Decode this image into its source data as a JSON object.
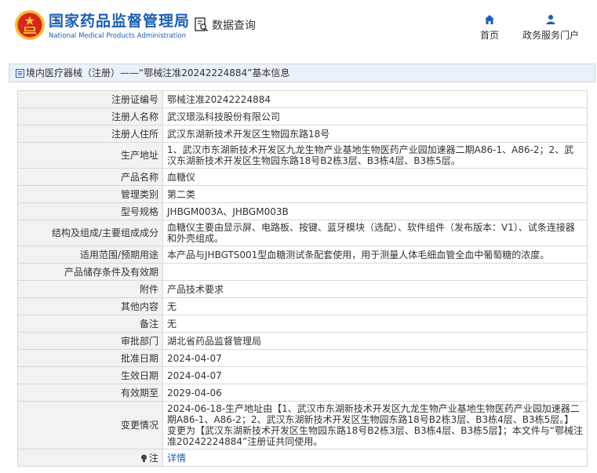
{
  "header": {
    "brand_cn": "国家药品监督管理局",
    "brand_en": "National Medical Products Administration",
    "query_label": "数据查询",
    "nav": {
      "home_label": "首页",
      "portal_label": "政务服务门户"
    }
  },
  "colors": {
    "brand_blue": "#1e5eb0",
    "emblem_red": "#d7261c",
    "emblem_gold": "#f0c030"
  },
  "breadcrumb": {
    "text": "境内医疗器械（注册）——“鄂械注准20242224884”基本信息"
  },
  "rows": [
    {
      "label": "注册证编号",
      "value": "鄂械注准20242224884"
    },
    {
      "label": "注册人名称",
      "value": "武汉璟泓科技股份有限公司"
    },
    {
      "label": "注册人住所",
      "value": "武汉东湖新技术开发区生物园东路18号"
    },
    {
      "label": "生产地址",
      "value": "1、武汉市东湖新技术开发区九龙生物产业基地生物医药产业园加速器二期A86-1、A86-2；2、武汉东湖新技术开发区生物园东路18号B2栋3层、B3栋4层、B3栋5层。"
    },
    {
      "label": "产品名称",
      "value": "血糖仪"
    },
    {
      "label": "管理类别",
      "value": "第二类"
    },
    {
      "label": "型号规格",
      "value": "JHBGM003A、JHBGM003B"
    },
    {
      "label": "结构及组成/主要组成成分",
      "value": "血糖仪主要由显示屏、电路板、按键、蓝牙模块（选配）、软件组件（发布版本：V1）、试条连接器和外壳组成。"
    },
    {
      "label": "适用范围/预期用途",
      "value": "本产品与JHBGTS001型血糖测试条配套使用，用于测量人体毛细血管全血中葡萄糖的浓度。"
    },
    {
      "label": "产品储存条件及有效期",
      "value": ""
    },
    {
      "label": "附件",
      "value": "产品技术要求"
    },
    {
      "label": "其他内容",
      "value": "无"
    },
    {
      "label": "备注",
      "value": "无"
    },
    {
      "label": "审批部门",
      "value": "湖北省药品监督管理局"
    },
    {
      "label": "批准日期",
      "value": "2024-04-07"
    },
    {
      "label": "生效日期",
      "value": "2024-04-07"
    },
    {
      "label": "有效期至",
      "value": "2029-04-06"
    },
    {
      "label": "变更情况",
      "value": "2024-06-18-生产地址由【1、武汉市东湖新技术开发区九龙生物产业基地生物医药产业园加速器二期A86-1、A86-2；2、武汉东湖新技术开发区生物园东路18号B2栋3层、B3栋4层、B3栋5层。】变更为【武汉东湖新技术开发区生物园东路18号B2栋3层、B3栋4层、B3栋5层】；本文件与“鄂械注准20242224884”注册证共同使用。"
    }
  ],
  "note_row": {
    "label": "注",
    "link_text": "详情"
  }
}
